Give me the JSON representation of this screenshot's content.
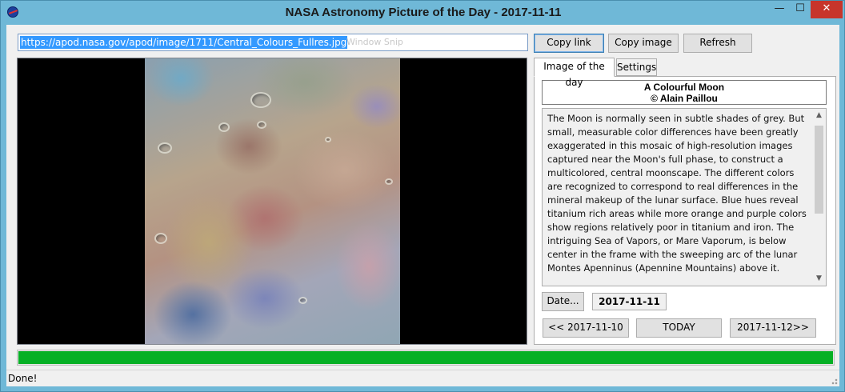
{
  "window": {
    "title": "NASA Astronomy Picture of the Day - 2017-11-11",
    "app_icon": "nasa-logo-icon",
    "controls": {
      "minimize": "—",
      "maximize": "☐",
      "close": "✕"
    }
  },
  "toolbar": {
    "url": "https://apod.nasa.gov/apod/image/1711/Central_Colours_Fullres.jpg",
    "url_ghost_text": "Window Snip",
    "copy_link_label": "Copy link",
    "copy_image_label": "Copy image",
    "refresh_label": "Refresh"
  },
  "tabs": [
    {
      "label": "Image of the day",
      "active": true
    },
    {
      "label": "Settings",
      "active": false
    }
  ],
  "apod": {
    "title": "A Colourful Moon",
    "credit": "© Alain Paillou",
    "explanation": "The Moon is normally seen in subtle shades of grey. But small, measurable color differences have been greatly exaggerated in this mosaic of high-resolution images captured near the Moon's full phase, to construct a multicolored, central moonscape. The different colors are recognized to correspond to real differences in the mineral makeup of the lunar surface. Blue hues reveal titanium rich areas while more orange and purple colors show regions relatively poor in titanium and iron. The intriguing Sea of Vapors, or Mare Vaporum, is below center in the frame with the sweeping arc of the lunar Montes Apenninus (Apennine Mountains) above it."
  },
  "date_controls": {
    "date_button_label": "Date...",
    "current_date": "2017-11-11",
    "prev_label": "<< 2017-11-10",
    "today_label": "TODAY",
    "next_label": "2017-11-12>>"
  },
  "progress": {
    "percent": 100,
    "color": "#06b025"
  },
  "status": {
    "text": "Done!"
  },
  "colors": {
    "titlebar": "#6fb8d7",
    "close": "#c7352b",
    "selection": "#3399ff"
  }
}
